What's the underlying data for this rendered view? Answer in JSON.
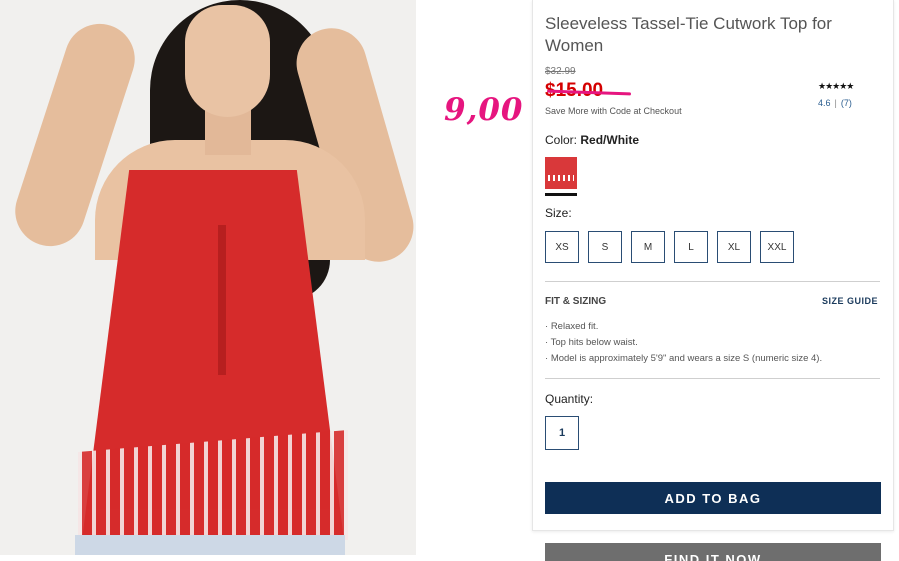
{
  "product": {
    "title": "Sleeveless Tassel-Tie Cutwork Top for Women",
    "original_price": "$32.99",
    "sale_price": "$15.00",
    "promo_text": "Save More with Code at Checkout",
    "rating": {
      "stars": "★★★★★",
      "score": "4.6",
      "count": "(7)"
    },
    "color_label": "Color:",
    "color_value": "Red/White",
    "size_label": "Size:",
    "sizes": [
      "XS",
      "S",
      "M",
      "L",
      "XL",
      "XXL"
    ],
    "fit_title": "FIT & SIZING",
    "size_guide": "SIZE GUIDE",
    "fit_bullets": [
      "Relaxed fit.",
      "Top hits below waist.",
      "Model is approximately 5'9\" and wears a size S (numeric size 4)."
    ],
    "quantity_label": "Quantity:",
    "quantity_value": "1",
    "add_to_bag": "ADD TO BAG",
    "find_it_now": "FIND IT NOW"
  },
  "annotation": {
    "handwritten_price": "9,00"
  },
  "colors": {
    "accent_navy": "#0e2f56",
    "sale_red": "#d40000",
    "annotation_pink": "#e6157f"
  }
}
